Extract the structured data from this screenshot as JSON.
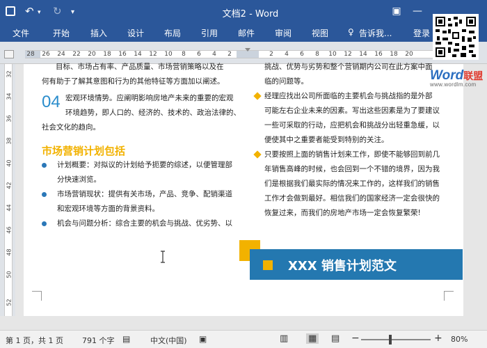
{
  "titlebar": {
    "title": "文档2  -  Word",
    "minimize": "—",
    "restore": "❐",
    "close": "✕",
    "ribbon_display": "▣"
  },
  "ribbon": {
    "tabs": [
      "文件",
      "开始",
      "插入",
      "设计",
      "布局",
      "引用",
      "邮件",
      "审阅",
      "视图"
    ],
    "tell_me": "告诉我...",
    "login": "登录"
  },
  "ruler": {
    "ticks": [
      "28",
      "26",
      "24",
      "22",
      "20",
      "18",
      "16",
      "14",
      "12",
      "10",
      "8",
      "6",
      "4",
      "2",
      "",
      "2",
      "4",
      "6",
      "8",
      "10",
      "12",
      "14",
      "16",
      "18",
      "20"
    ]
  },
  "vruler": {
    "numbers": [
      "32",
      "34",
      "36",
      "38",
      "40",
      "42",
      "44",
      "46",
      "48",
      "50",
      "52"
    ]
  },
  "document": {
    "left": {
      "line1": "目标、市场占有率、产品质量、市场营销策略以及在",
      "line2": "何有助于了解其意图和行为的其他特征等方面加以阐述。",
      "item04_num": "04",
      "item04_line1": "宏观环境情势。应阐明影响房地产未来的重要的宏观",
      "item04_line2": "环境趋势，即人口的、经济的、技术的、政治法律的、",
      "item04_line3": "社会文化的趋向。",
      "heading": "市场营销计划包括",
      "bullets": [
        {
          "l1": "计划概要：对拟议的计划给予扼要的综述，以便管理部",
          "l2": "分快速浏览。"
        },
        {
          "l1": "市场营销现状：提供有关市场，产品、竞争、配销渠道",
          "l2": "和宏观环境等方面的背景资料。"
        },
        {
          "l1": "机会与问题分析：综合主要的机会与挑战、优劣势、以",
          "l2": ""
        }
      ]
    },
    "right": {
      "top_line1": "挑战、优势与劣势和整个营销期内公司在此方案中面",
      "top_line2": "临的问题等。",
      "items": [
        {
          "lines": [
            "经理应找出公司所面临的主要机会与挑战指的是外部",
            "可能左右企业未来的因素。写出这些因素是为了要建议",
            "一些可采取的行动，应把机会和挑战分出轻重急缓，以",
            "便使其中之重要者能受到特别的关注。"
          ]
        },
        {
          "lines": [
            "只要按照上面的销售计划来工作，即使不能够回到前几",
            "年销售高峰的时候，也会回到一个不错的境界，因为我",
            "们是根据我们最实际的情况来工作的，这样我们的销售",
            "工作才会做到最好。相信我们的国家经济一定会很快的",
            "恢复过来，而我们的房地产市场一定会恢复繁荣!"
          ]
        }
      ]
    },
    "banner_title": "XXX 销售计划范文"
  },
  "watermark": {
    "word": "Word",
    "cn": "联盟",
    "url": "www.wordlm.com"
  },
  "statusbar": {
    "page": "第 1 页，共 1 页",
    "words": "791 个字",
    "language": "中文(中国)",
    "zoom_minus": "−",
    "zoom_plus": "+",
    "zoom": "80%"
  },
  "colors": {
    "ribbon": "#2b579a",
    "accent_yellow": "#f2b200",
    "banner_blue": "#2478b0",
    "number_blue": "#2b8dcc"
  }
}
